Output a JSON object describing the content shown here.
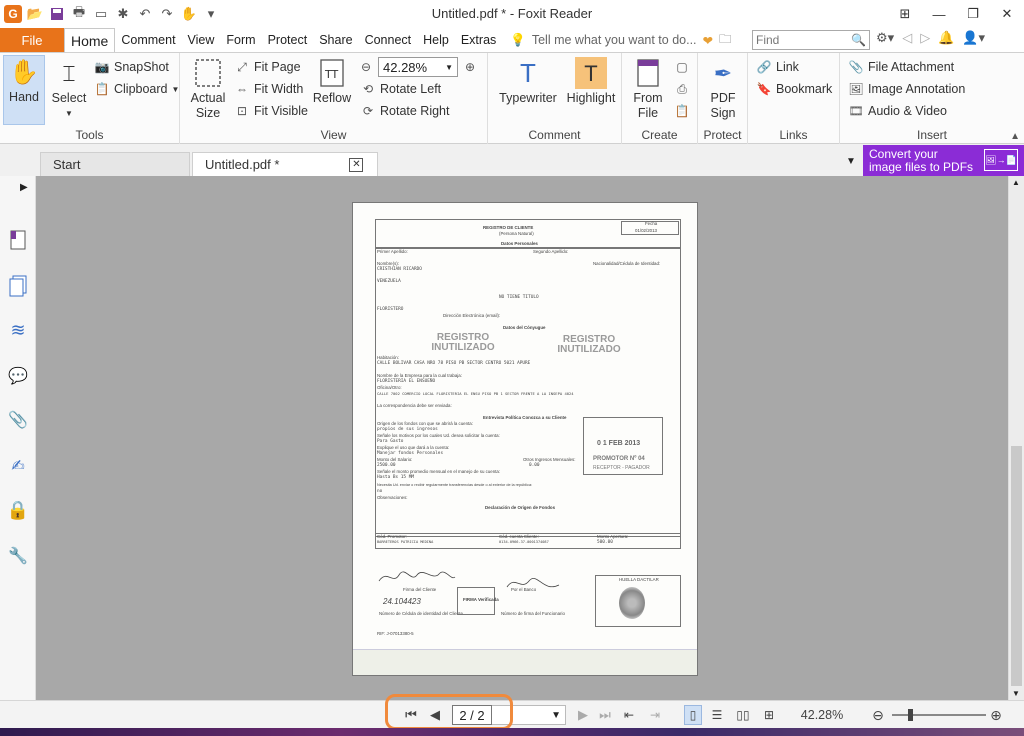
{
  "window": {
    "title": "Untitled.pdf * - Foxit Reader",
    "app_logo": "G"
  },
  "menu": {
    "file": "File",
    "tabs": [
      "Home",
      "Comment",
      "View",
      "Form",
      "Protect",
      "Share",
      "Connect",
      "Help",
      "Extras"
    ],
    "tell_me": "Tell me what you want to do...",
    "find_placeholder": "Find"
  },
  "ribbon": {
    "tools": {
      "label": "Tools",
      "hand": "Hand",
      "select": "Select",
      "snapshot": "SnapShot",
      "clipboard": "Clipboard"
    },
    "view": {
      "label": "View",
      "actual_size_1": "Actual",
      "actual_size_2": "Size",
      "fit_page": "Fit Page",
      "fit_width": "Fit Width",
      "fit_visible": "Fit Visible",
      "reflow": "Reflow",
      "zoom": "42.28%",
      "rotate_left": "Rotate Left",
      "rotate_right": "Rotate Right"
    },
    "comment": {
      "label": "Comment",
      "typewriter": "Typewriter",
      "highlight": "Highlight"
    },
    "create": {
      "label": "Create",
      "from_file_1": "From",
      "from_file_2": "File"
    },
    "protect": {
      "label": "Protect",
      "pdf_sign_1": "PDF",
      "pdf_sign_2": "Sign"
    },
    "links": {
      "label": "Links",
      "link": "Link",
      "bookmark": "Bookmark"
    },
    "insert": {
      "label": "Insert",
      "file_attachment": "File Attachment",
      "image_annotation": "Image Annotation",
      "audio_video": "Audio & Video"
    }
  },
  "doc_tabs": [
    {
      "label": "Start"
    },
    {
      "label": "Untitled.pdf *"
    }
  ],
  "promo": {
    "line1": "Convert your",
    "line2": "image files to PDFs"
  },
  "status": {
    "page": "2 / 2",
    "zoom": "42.28%"
  },
  "document": {
    "title": "REGISTRO DE CLIENTE",
    "subtitle": "(Persona Natural)",
    "fecha_label": "Fecha",
    "fecha": "01/02/2013",
    "section1": "Datos Personales",
    "section2": "Datos del Cónyugue",
    "section3": "Entrevista Política Conozca a su Cliente",
    "section4": "Declaración de Origen de Fondos",
    "primer_apellido": "Primer Apellido:",
    "segundo_apellido": "Segundo Apellido:",
    "nombres": "Nombre(s):",
    "nombre_val": "CRISTHIAN RICARDO",
    "nacionalidad": "Nacionalidad/Cédula de Identidad:",
    "pais": "VENEZUELA",
    "profesion": "NO TIENE TITULO",
    "ocupacion": "FLORISTERO",
    "email": "Dirección Electrónica (email):",
    "stamp1": "REGISTRO INUTILIZADO",
    "stamp2": "REGISTRO INUTILIZADO",
    "habitacion": "Habitación:",
    "direccion": "CALLE BOLIVAR CASA NRO 78 PISO PB SECTOR CENTRO 5021 APURE",
    "empresa_label": "Nombre de la Empresa para la cual trabaja:",
    "empresa": "FLORISTERIA EL ENSUEÑO",
    "oficina_label": "Oficina/Otro:",
    "oficina": "CALLE 7002 COMERCIO LOCAL FLORISTERIA EL ENSU PISO PB 1 SECTOR FRENTE A LA INSEPA 4024",
    "correspondencia": "La correspondencia debe ser enviada:",
    "origen": "Origen de los fondos con que se abrirá la cuenta:",
    "origen_val": "propios de sus ingresos",
    "motivos": "Señale los motivos por los cuales Ud. desea solicitar la cuenta:",
    "motivos_val": "Para Gasto",
    "uso": "Explique el uso que dará a la cuenta:",
    "uso_val": "Manejar fondos Personales",
    "monto_salario": "Monto del Salario:",
    "monto_salario_val": "2500.00",
    "otros_ingresos": "Otros Ingresos Mensuales:",
    "otros_ingresos_val": "0.00",
    "monto_mensual": "Señale el monto promedio mensual en el manejo de su cuenta:",
    "monto_mensual_val": "Hasta Bs 15 MM",
    "transferencias": "Necesita Ud. enviar o recibir regularmente transferencias desde o al exterior de la república:",
    "transferencias_val": "no",
    "observaciones": "Observaciones:",
    "stamp_fecha": "0 1 FEB 2013",
    "stamp_promotor": "PROMOTOR Nº 04",
    "stamp_pagador": "RECEPTOR - PAGADOR",
    "firma_cliente": "Firma del Cliente",
    "firma_banco": "Por el Banco",
    "cedula_cliente": "Número de Cédula de identidad del Cliente",
    "firma_funcionario": "Número de firma del Funcionario",
    "huella": "HUELLA DACTILAR",
    "firma_verificada": "FIRMA Verificada",
    "rif": "RIF: J-07013380-5",
    "cod_promotor": "Cód. Promotor:",
    "promotor_val": "BARRETEROS PATRICIA MEDINA",
    "cod_cuenta": "Cód. cuenta Cliente:",
    "cuenta_val": "0134-0966-37-0001374087",
    "monto_apertura": "Monto Apertura:",
    "monto_apertura_val": "500.00",
    "cedula_val": "24.104423"
  }
}
